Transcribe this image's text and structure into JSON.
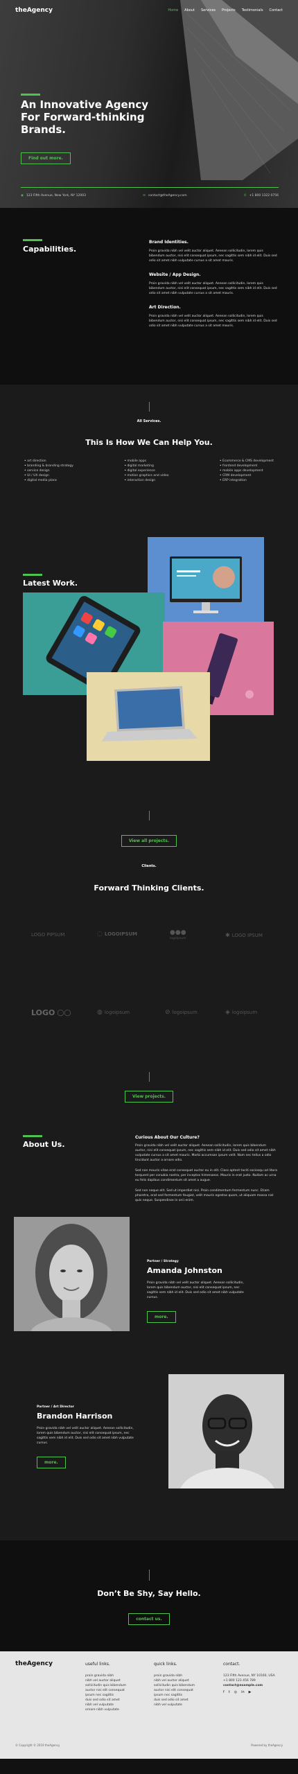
{
  "nav": {
    "logo": "theAgency",
    "items": [
      "Home",
      "About",
      "Services",
      "Projects",
      "Testimonials",
      "Contact"
    ]
  },
  "hero": {
    "title": "An Innovative Agency For Forward-thinking Brands.",
    "cta": "Find out more.",
    "address": "123 Fifth Avenue, New York, NY 12003",
    "email": "contact@theAgency.com",
    "phone": "+1 800 1322 0756"
  },
  "capabilities": {
    "title": "Capabilities.",
    "items": [
      {
        "title": "Brand Identities.",
        "text": "Proin gravida nibh vel velit auctor aliquet. Aenean sollicitudin, lorem quis bibendum auctor, nisi elit consequat ipsum, nec sagittis sem nibh id elit. Duis sed odio sit amet nibh vulputate cursus a sit amet mauris."
      },
      {
        "title": "Website / App Design.",
        "text": "Proin gravida nibh vel velit auctor aliquet. Aenean sollicitudin, lorem quis bibendum auctor, nisi elit consequat ipsum, nec sagittis sem nibh id elit. Duis sed odio sit amet nibh vulputate cursus a sit amet mauris."
      },
      {
        "title": "Art Direction.",
        "text": "Proin gravida nibh vel velit auctor aliquet. Aenean sollicitudin, lorem quis bibendum auctor, nisi elit consequat ipsum, nec sagittis sem nibh id elit. Duis sed odio sit amet nibh vulputate cursus a sit amet mauris."
      }
    ]
  },
  "services": {
    "label": "All Services.",
    "title": "This Is How We Can Help You.",
    "col1": [
      "art direction",
      "branding & branding strategy",
      "service design",
      "UI / UX design",
      "digital media plans"
    ],
    "col2": [
      "mobile apps",
      "digital marketing",
      "digital experience",
      "motion graphics and video",
      "interaction design"
    ],
    "col3": [
      "Ecommerce & CMS development",
      "frontend development",
      "mobile apps development",
      "CRM development",
      "ERP integration"
    ]
  },
  "work": {
    "title": "Latest Work.",
    "cta": "View all projects."
  },
  "clients": {
    "label": "Clients.",
    "title": "Forward Thinking Clients.",
    "cta": "View projects.",
    "logos": [
      "LOGO PIPSUM",
      "LOGOIPSUM",
      "logoipsum",
      "LOGO IPSUM",
      "LOGO",
      "logoipsum",
      "logoipsum",
      "logoipsum"
    ]
  },
  "about": {
    "title": "About Us.",
    "subtitle": "Curious About Our Culture?",
    "p1": "Proin gravida nibh vel velit auctor aliquet. Aenean sollicitudin, lorem quis bibendum auctor, nisi elit consequat ipsum, nec sagittis sem nibh id elit. Duis sed odio sit amet nibh vulputate cursus a sit amet mauris. Morbi accumsan ipsum velit. Nam nec tellus a odio tincidunt auctor a ornare odio.",
    "p2": "Sed non mauris vitae erat consequat auctor eu in elit. Class aptent taciti sociosqu ad litora torquent per conubia nostra, per inceptos himenaeos. Mauris in erat justo. Nullam ac urna eu felis dapibus condimentum sit amet a augue.",
    "p3": "Sed non neque elit. Sed ut imperdiet nisi. Proin condimentum fermentum nunc. Etiam pharetra, erat sed fermentum feugiat, velit mauris egestas quam, ut aliquam massa nisl quis neque. Suspendisse in orci enim."
  },
  "team": [
    {
      "role": "Partner / Strategy",
      "name": "Amanda Johnston",
      "text": "Proin gravida nibh vel velit auctor aliquet. Aenean sollicitudin, lorem quis bibendum auctor, nisi elit consequat ipsum, nec sagittis sem nibh id elit. Duis sed odio sit amet nibh vulputate cursus.",
      "cta": "more."
    },
    {
      "role": "Partner / Art Director",
      "name": "Brandon Harrison",
      "text": "Proin gravida nibh vel velit auctor aliquet. Aenean sollicitudin, lorem quis bibendum auctor, nisi elit consequat ipsum, nec sagittis sem nibh id elit. Duis sed odio sit amet nibh vulputate cursus.",
      "cta": "more."
    }
  ],
  "cta": {
    "title": "Don’t Be Shy, Say Hello.",
    "button": "contact us."
  },
  "footer": {
    "logo": "theAgency",
    "useful": {
      "title": "useful links.",
      "links": [
        "proin gravida nibh",
        "nibh vel auctor aliquet",
        "sollicitudin quis bibendum",
        "auctor nisi elit consequat",
        "ipsum nec sagittis",
        "duis sed odio sit amet",
        "nibh vel vulputate",
        "ornare nibh vulputate"
      ]
    },
    "quick": {
      "title": "quick links.",
      "links": [
        "proin gravida nibh",
        "nibh vel auctor aliquet",
        "sollicitudin quis bibendum",
        "auctor nisi elit consequat",
        "ipsum nec sagittis",
        "duis sed odio sit amet",
        "nibh vel vulputate"
      ]
    },
    "contact": {
      "title": "contact.",
      "address": "123 Fifth Avenue, NY 10160, USA",
      "phone": "+1 800 123 456 789",
      "email": "contact@example.com"
    },
    "copyright": "© Copyright © 2019 theAgency",
    "powered": "Powered by theAgency"
  },
  "colors": {
    "accent": "#4fc34f"
  }
}
